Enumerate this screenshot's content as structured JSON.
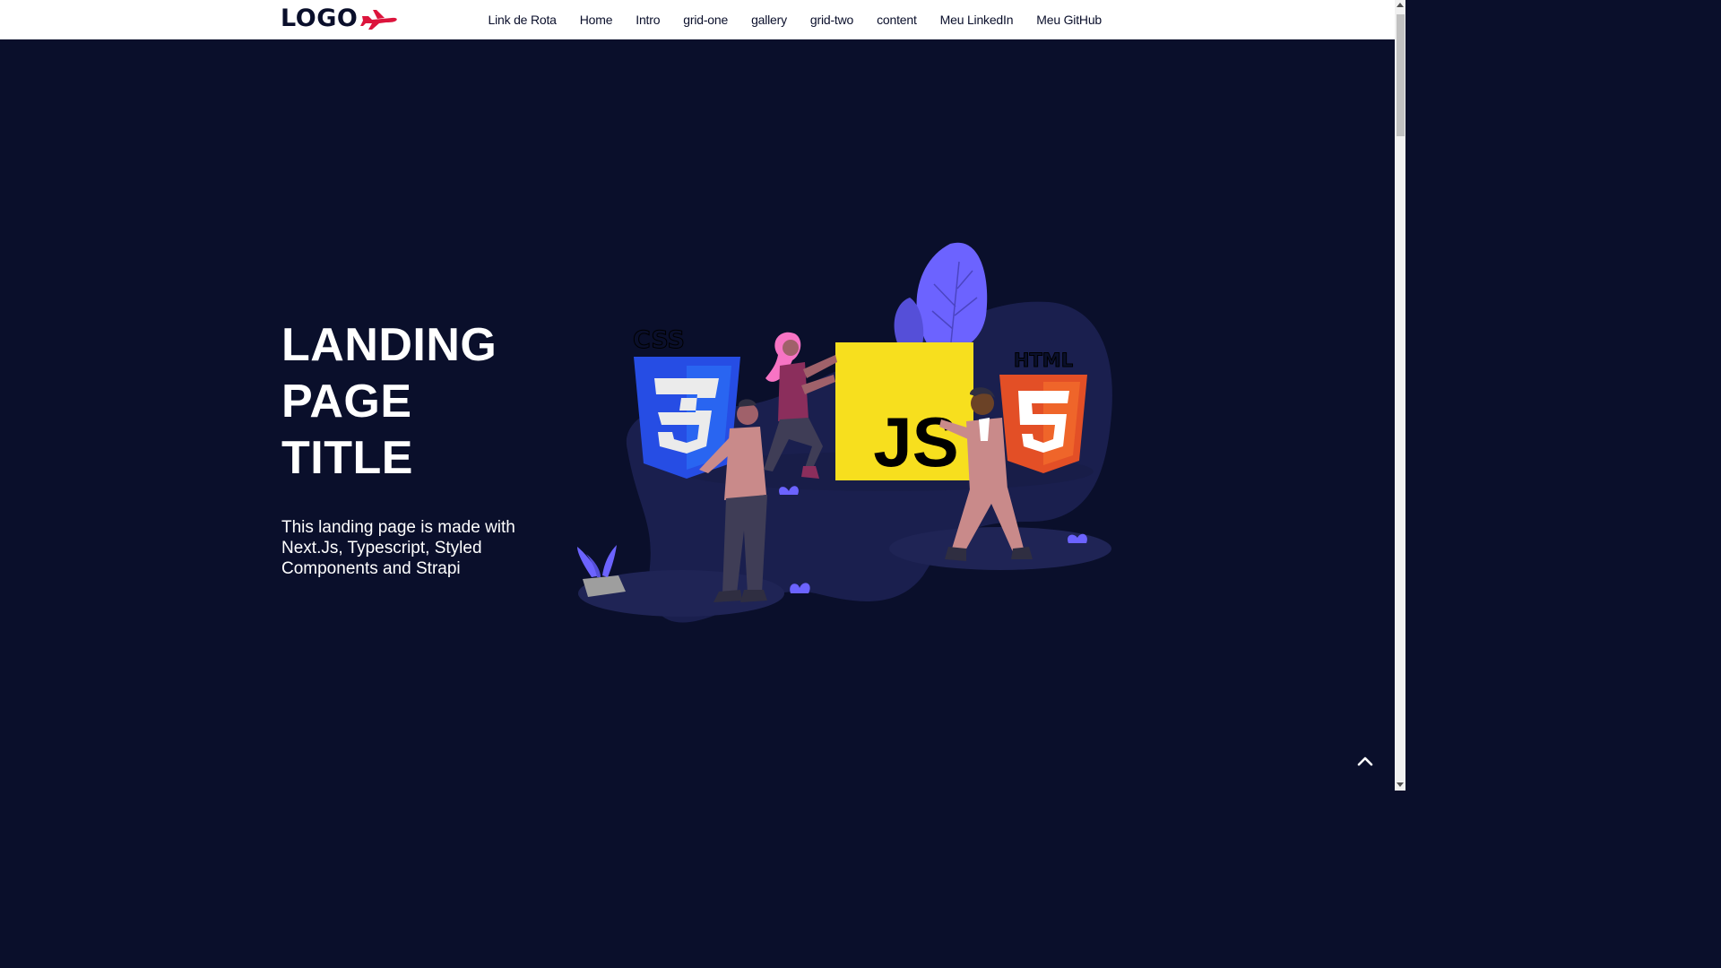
{
  "header": {
    "logo_text": "LOGO",
    "logo_icon": "airplane-icon",
    "nav": [
      {
        "label": "Link de Rota"
      },
      {
        "label": "Home"
      },
      {
        "label": "Intro"
      },
      {
        "label": "grid-one"
      },
      {
        "label": "gallery"
      },
      {
        "label": "grid-two"
      },
      {
        "label": "content"
      },
      {
        "label": "Meu LinkedIn"
      },
      {
        "label": "Meu GitHub"
      }
    ]
  },
  "hero": {
    "title_lines": [
      "LANDING",
      "PAGE",
      "TITLE"
    ],
    "description": "This landing page is made with Next.Js, Typescript, Styled Components and Strapi",
    "illustration_labels": {
      "css": "CSS",
      "js": "JS",
      "html": "HTML"
    }
  },
  "back_to_top_icon": "chevron-up-icon",
  "colors": {
    "background": "#0a0f2b",
    "header_bg": "#ffffff",
    "accent_red": "#dc143c",
    "text_light": "#ffffff",
    "text_dark": "#0a0f2b"
  }
}
